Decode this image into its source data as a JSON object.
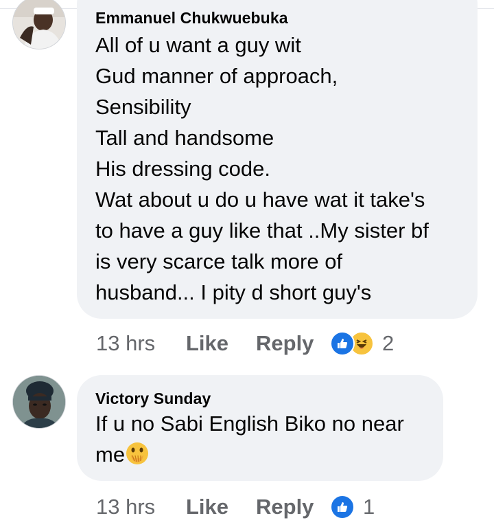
{
  "colors": {
    "bubble_bg": "#f0f2f5",
    "meta_text": "#65676b",
    "like_blue": "#1b74e4",
    "haha_yellow": "#f7c33e"
  },
  "comments": [
    {
      "author": "Emmanuel Chukwuebuka",
      "lines": [
        "All of u want a guy wit",
        "Gud manner of approach,",
        "Sensibility",
        "Tall and handsome",
        "His dressing code.",
        "Wat about u do u have wat it take's",
        "to have a guy like that ..My sister bf",
        "is very scarce talk more of",
        "husband... I pity d short guy's"
      ],
      "time": "13 hrs",
      "like_label": "Like",
      "reply_label": "Reply",
      "reactions": [
        "like-icon",
        "haha-icon"
      ],
      "reaction_count": "2"
    },
    {
      "author": "Victory Sunday",
      "lines": [
        "If u no Sabi English Biko no near",
        "me"
      ],
      "trailing_emoji": "hand-over-mouth-emoji",
      "time": "13 hrs",
      "like_label": "Like",
      "reply_label": "Reply",
      "reactions": [
        "like-icon"
      ],
      "reaction_count": "1"
    }
  ]
}
